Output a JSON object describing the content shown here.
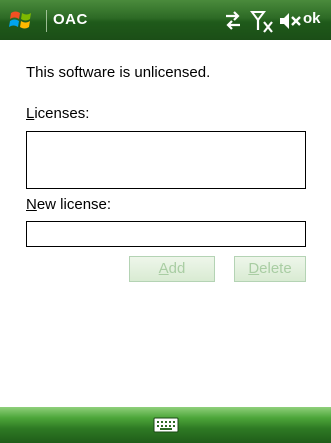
{
  "titlebar": {
    "app_title": "OAC",
    "ok_label": "ok",
    "status_icons": [
      "connectivity-icon",
      "signal-off-icon",
      "speaker-muted-icon"
    ]
  },
  "content": {
    "message": "This software is unlicensed.",
    "licenses_label_accel": "L",
    "licenses_label_rest": "icenses:",
    "licenses": [],
    "new_license_label_accel": "N",
    "new_license_label_rest": "ew license:",
    "new_license_value": "",
    "add_button_accel": "A",
    "add_button_rest": "dd",
    "delete_button_accel": "D",
    "delete_button_rest": "elete"
  },
  "bottombar": {
    "keyboard_icon": "keyboard-icon"
  },
  "colors": {
    "title_green": "#2d6a25",
    "bottom_green": "#4da63a",
    "disabled_text": "#a9cda3"
  }
}
